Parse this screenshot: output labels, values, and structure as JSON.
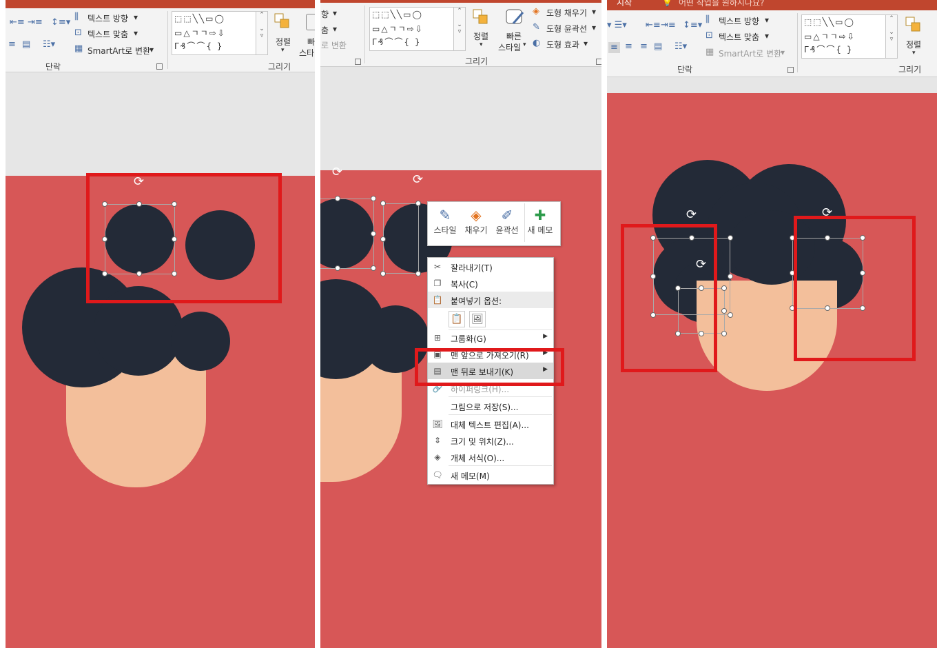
{
  "colors": {
    "slide_bg": "#d75757",
    "hair": "#232a37",
    "face": "#f3bf9b",
    "highlight_box": "#e0191b",
    "ribbon_top": "#c0462e"
  },
  "ribbon": {
    "text_direction": "텍스트 방향",
    "text_align": "텍스트 맞춤",
    "smartart_convert": "SmartArt로 변환",
    "smartart_convert_short": "로 변환",
    "text_direction_short": "향",
    "text_align_short": "춤",
    "paragraph_group": "단락",
    "drawing_group": "그리기",
    "arrange": "정렬",
    "quick_styles_l1": "빠른",
    "quick_styles_l2": "스타일",
    "quick_short_l1": "빠",
    "quick_short_l2": "스타",
    "shape_fill": "도형 채우기",
    "shape_outline": "도형 윤곽선",
    "shape_effects": "도형 효과",
    "tell_me": "어떤 작업을 원하시나요?",
    "tab_start": "시작"
  },
  "shapes_gallery_rows": [
    "⬚⬚╲╲▭◯",
    "▭△ㄱㄱ⇨⇩",
    "ᒥ₰⌒⌒{ }"
  ],
  "mini_toolbar": [
    {
      "icon": "✎",
      "label": "스타일"
    },
    {
      "icon": "◈",
      "label": "채우기"
    },
    {
      "icon": "✐",
      "label": "윤곽선"
    },
    {
      "icon": "✚",
      "label": "새 메모"
    }
  ],
  "context_menu": {
    "cut": "잘라내기(T)",
    "copy": "복사(C)",
    "paste_options": "붙여넣기 옵션:",
    "group": "그룹화(G)",
    "bring_front": "맨 앞으로 가져오기(R)",
    "send_back": "맨 뒤로 보내기(K)",
    "hyperlink": "하이퍼링크(H)...",
    "save_as_picture": "그림으로 저장(S)...",
    "edit_alt_text": "대체 텍스트 편집(A)...",
    "size_position": "크기 및 위치(Z)...",
    "format_object": "개체 서식(O)...",
    "new_comment": "새 메모(M)"
  }
}
